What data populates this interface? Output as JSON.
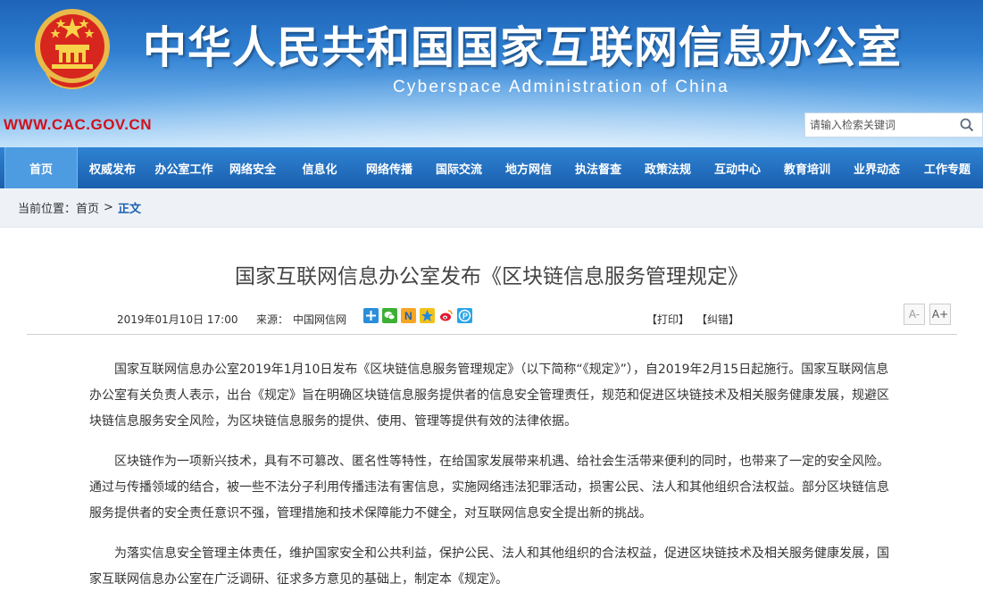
{
  "header": {
    "site_title": "中华人民共和国国家互联网信息办公室",
    "site_subtitle": "Cyberspace Administration of China",
    "site_url": "WWW.CAC.GOV.CN",
    "search_placeholder": "请输入检索关键词",
    "accent_color": "#1a5fae",
    "url_color": "#d0121b"
  },
  "nav": {
    "items": [
      {
        "label": "首页"
      },
      {
        "label": "权威发布"
      },
      {
        "label": "办公室工作"
      },
      {
        "label": "网络安全"
      },
      {
        "label": "信息化"
      },
      {
        "label": "网络传播"
      },
      {
        "label": "国际交流"
      },
      {
        "label": "地方网信"
      },
      {
        "label": "执法督查"
      },
      {
        "label": "政策法规"
      },
      {
        "label": "互动中心"
      },
      {
        "label": "教育培训"
      },
      {
        "label": "业界动态"
      },
      {
        "label": "工作专题"
      }
    ]
  },
  "breadcrumb": {
    "label": "当前位置：",
    "home": "首页",
    "sep": ">",
    "current": "正文"
  },
  "article": {
    "title": "国家互联网信息办公室发布《区块链信息服务管理规定》",
    "date": "2019年01月10日 17:00",
    "source_label": "来源：",
    "source": "中国网信网",
    "print": "【打印】",
    "correct": "【纠错】",
    "font_smaller": "A-",
    "font_larger": "A+",
    "paragraphs": [
      "国家互联网信息办公室2019年1月10日发布《区块链信息服务管理规定》（以下简称“《规定》”），自2019年2月15日起施行。国家互联网信息办公室有关负责人表示，出台《规定》旨在明确区块链信息服务提供者的信息安全管理责任，规范和促进区块链技术及相关服务健康发展，规避区块链信息服务安全风险，为区块链信息服务的提供、使用、管理等提供有效的法律依据。",
      "区块链作为一项新兴技术，具有不可篡改、匿名性等特性，在给国家发展带来机遇、给社会生活带来便利的同时，也带来了一定的安全风险。通过与传播领域的结合，被一些不法分子利用传播违法有害信息，实施网络违法犯罪活动，损害公民、法人和其他组织合法权益。部分区块链信息服务提供者的安全责任意识不强，管理措施和技术保障能力不健全，对互联网信息安全提出新的挑战。",
      "为落实信息安全管理主体责任，维护国家安全和公共利益，保护公民、法人和其他组织的合法权益，促进区块链技术及相关服务健康发展，国家互联网信息办公室在广泛调研、征求多方意见的基础上，制定本《规定》。"
    ]
  },
  "share_icons": [
    "plus-share-icon",
    "wechat-icon",
    "n-share-icon",
    "qzone-icon",
    "weibo-icon",
    "p-share-icon"
  ]
}
